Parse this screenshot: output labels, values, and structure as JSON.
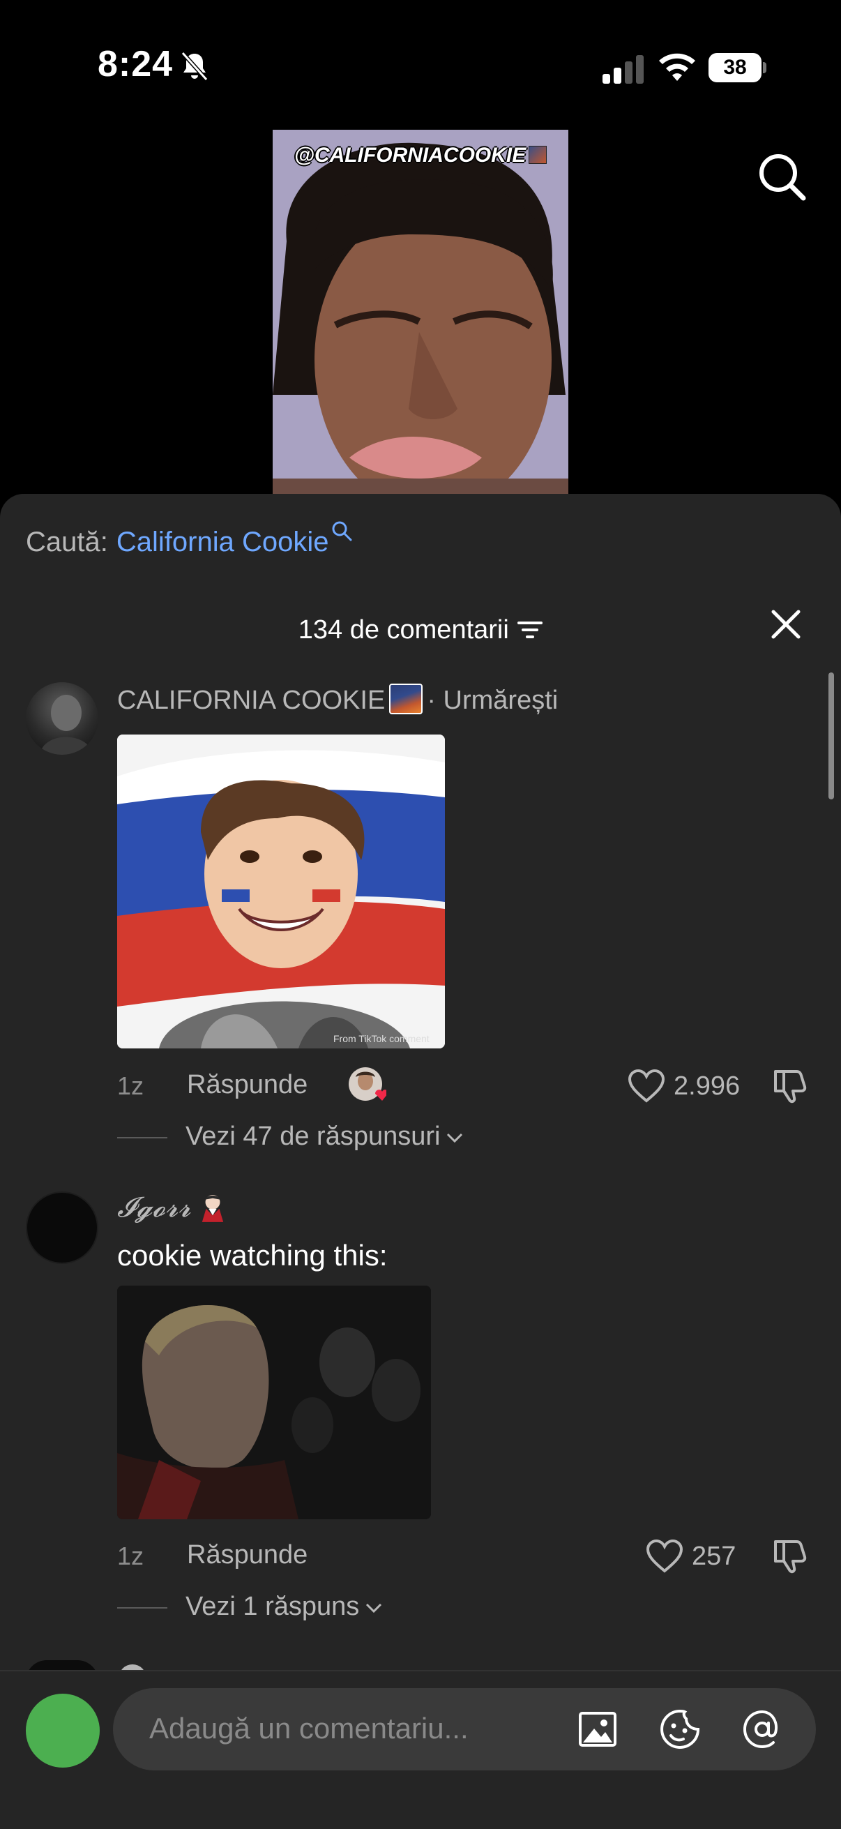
{
  "status_bar": {
    "time": "8:24",
    "battery": "38"
  },
  "video": {
    "handle": "@CALIFORNIACOOKIE"
  },
  "search": {
    "prefix": "Caută:",
    "term": "California Cookie"
  },
  "comments_header": {
    "count_label": "134 de comentarii"
  },
  "comments": [
    {
      "username": "CALIFORNIA COOKIE",
      "suffix": "· Urmărești",
      "text": "",
      "gif_watermark": "From TikTok comment",
      "time": "1z",
      "reply_label": "Răspunde",
      "likes": "2.996",
      "replies_label": "Vezi 47 de răspunsuri"
    },
    {
      "username": "𝓘𝓰𝓸𝓻𝓻",
      "suffix": "",
      "text": "cookie watching this:",
      "time": "1z",
      "reply_label": "Răspunde",
      "likes": "257",
      "replies_label": "Vezi 1 răspuns"
    }
  ],
  "composer": {
    "placeholder": "Adaugă un comentariu...",
    "icons": [
      "image-icon",
      "emoji-sticker-icon",
      "at-mention-icon"
    ]
  },
  "colors": {
    "sheet_bg": "#252525",
    "search_term": "#6fa8ff",
    "my_avatar": "#4caf50"
  }
}
